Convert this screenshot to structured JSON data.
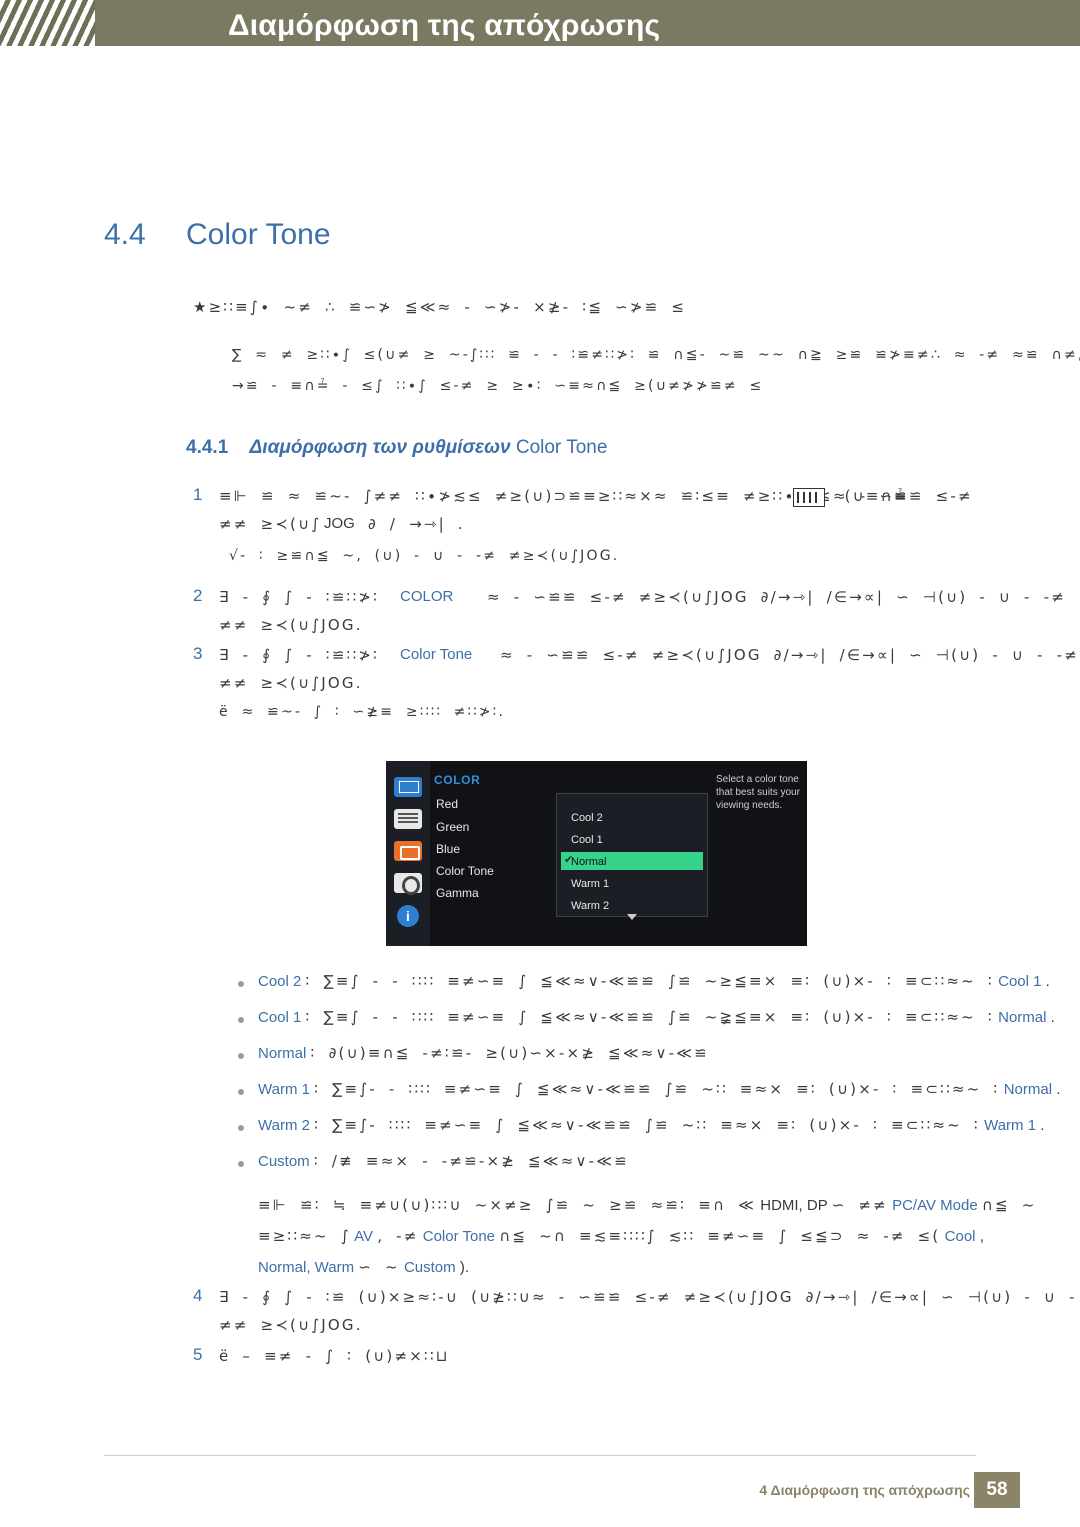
{
  "header": {
    "title": "Διαμόρφωση της απόχρωσης"
  },
  "section": {
    "number": "4.4",
    "title": "Color Tone"
  },
  "intro": {
    "line1": "★≥∷≡∫∙ ~≠ ∴ ≌∽≯ ≦≪≈ ‐ ∽≯‐ ⨯≱‐ ∶≦  ∽≯≌ ≤",
    "note_line1": "∑ ≂ ≠ ≥∷∙∫ ≤(∪≠ ≥  ~‐∫∷∶ ≌  ‐ ‐ ∶≌≠∷≯∶  ≌ ∩≦‐  ~≌   ~~ ∩≧ ≥≌  ≌≯≡≠∴  ≈ ‐≠ ≈≌ ∩≠,",
    "note_line2": "→≌ ‐ ≡∩≟   ‐ ≤∫  ∷∙∫ ≤‐≠ ≥  ≥∙∶ ∽≡≈∩≦ ≥(∪≠≯≯≌≠ ≤"
  },
  "subsection": {
    "number": "4.4.1",
    "title_greek": "Διαμόρφωση των ρυθμίσεων",
    "title_tail": "Color Tone"
  },
  "steps": [
    {
      "num": "1",
      "line1_pre": "≡⊩ ≌ ≈ ≌~‐ ∫≠≠ ∷∙≯≲≤ ≠≥(∪)⊃≌≡≥∷≈⨯≈ ≌∶≤≡ ≠≥∷∙∫ ≤ (∪≡∩≟",
      "line1_post": "≈ ‐ ∽≌≌ ≤‐≠",
      "line2_pre": "≠≠ ≥≺(∪∫",
      "line2_kw": "JOG",
      "line2_post": "∂ / →⇾| .",
      "line3": "√‐ ∶  ≥≌∩≦ ~, (∪) ‐ ∪ ‐ ‐≠ ≠≥≺(∪∫JOG."
    },
    {
      "num": "2",
      "line1_pre": "∃ ‐ ∮ ∫  ‐ ∶≌∷≯∶",
      "line1_kw": "COLOR",
      "line1_mid": "≈ ‐ ∽≌≌ ≤‐≠ ≠≥≺(∪∫JOG ∂/→⇾| /∈→∝| ∽ ⊣(∪) ‐ ∪ ‐ ‐≠",
      "line2": "≠≠ ≥≺(∪∫JOG."
    },
    {
      "num": "3",
      "line1_pre": "∃ ‐ ∮ ∫  ‐ ∶≌∷≯∶",
      "line1_kw": "Color Tone",
      "line1_mid": "≈ ‐ ∽≌≌ ≤‐≠ ≠≥≺(∪∫JOG ∂/→⇾| /∈→∝| ∽ ⊣(∪) ‐ ∪ ‐ ‐≠",
      "line2": "≠≠ ≥≺(∪∫JOG.",
      "line3": "ë     ≈  ≌~‐ ∫ ∶  ∽≱≡ ≥∷∷ ≠∷≯∶."
    },
    {
      "num": "4",
      "line1_pre": "∃ ‐ ∮ ∫  ‐ ∶≌ (∪)⨯≥≈∶‐∪ (∪≱∷∪≈ ‐ ∽≌≌ ≤‐≠ ≠≥≺(∪∫JOG ∂/→⇾| /∈→∝| ∽ ⊣(∪) ‐ ∪ ‐ ‐≠",
      "line2": "≠≠ ≥≺(∪∫JOG."
    },
    {
      "num": "5",
      "line1": "ë  –  ≡≠ ‐ ∫ ∶  (∪)≠⨯∷⊔"
    }
  ],
  "osd": {
    "category": "COLOR",
    "items": [
      "Red",
      "Green",
      "Blue",
      "Color Tone",
      "Gamma"
    ],
    "submenu": [
      "Cool 2",
      "Cool 1",
      "Normal",
      "Warm 1",
      "Warm 2"
    ],
    "selected": "Normal",
    "help_text": "Select a color tone that best suits your viewing needs.",
    "check_glyph": "✔",
    "info_glyph": "i"
  },
  "bullets": [
    {
      "label": "Cool 2",
      "pre": "∶ ∑≡∫ ‐  ‐ ∷∷ ≡≠∽≡  ∫  ≦≪≈∨‐≪≌≌  ∫≌ ~≥≦≡⨯  ≡∶  (∪)⨯‐ ∶ ≡⊂∷≈~ ∶",
      "kw2": "Cool 1",
      "post": "."
    },
    {
      "label": "Cool 1",
      "pre": "∶ ∑≡∫ ‐  ‐ ∷∷ ≡≠∽≡  ∫  ≦≪≈∨‐≪≌≌  ∫≌ ~≩≦≡⨯  ≡∶  (∪)⨯‐ ∶ ≡⊂∷≈~ ∶",
      "kw2": "Normal",
      "post": "."
    },
    {
      "label": "Normal",
      "pre": "∶ ∂(∪)≡∩≦  ‐≠∶≌‐ ≥(∪)∽⨯‐⨯≱ ≦≪≈∨‐≪≌",
      "kw2": "",
      "post": ""
    },
    {
      "label": "Warm 1",
      "pre": "∶ ∑≡∫‐  ‐ ∷∷ ≡≠∽≡  ∫  ≦≪≈∨‐≪≌≌  ∫≌ ~∷ ≡≈⨯  ≡∶  (∪)⨯‐ ∶ ≡⊂∷≈~ ∶",
      "kw2": "Normal",
      "post": "."
    },
    {
      "label": "Warm 2",
      "pre": "∶ ∑≡∫‐   ∷∷ ≡≠∽≡  ∫  ≦≪≈∨‐≪≌≌  ∫≌ ~∷ ≡≈⨯  ≡∶  (∪)⨯‐ ∶ ≡⊂∷≈~ ∶",
      "kw2": "Warm 1",
      "post": "."
    },
    {
      "label": "Custom",
      "pre": "∶ /≢  ≡≈⨯ ‐  ‐≠≌‐⨯≱ ≦≪≈∨‐≪≌",
      "kw2": "",
      "post": ""
    }
  ],
  "note": {
    "line1_pre": "≡⊩ ≌∶ ≒ ≡≠∪(∪)∷∶∪ ~⨯≠≥ ∫≌ ~ ≥≌   ≈≌∶ ≡∩ ≪",
    "line1_kw1": "HDMI, DP",
    "line1_mid": "∽ ≠≠",
    "line1_kw2": "PC/AV Mode",
    "line1_post": "∩≦ ~",
    "line2_pre": "≡≥∷≈~ ∫",
    "line2_kw1": "AV",
    "line2_mid": ", ‐≠",
    "line2_kw2": "Color Tone",
    "line2_mid2": "∩≦ ~∩  ≡≲≡∷∷∫  ≲∷ ≡≠∽≡  ∫ ≤≦⊃ ≈ ‐≠ ≤(",
    "line2_kw3": "Cool",
    "line2_post": ",",
    "line3_kw": "Normal, Warm",
    "line3_mid": "∽ ~",
    "line3_kw2": "Custom",
    "line3_post": ")."
  },
  "footer": {
    "chapter": "4 Διαμόρφωση της απόχρωσης",
    "page": "58"
  }
}
